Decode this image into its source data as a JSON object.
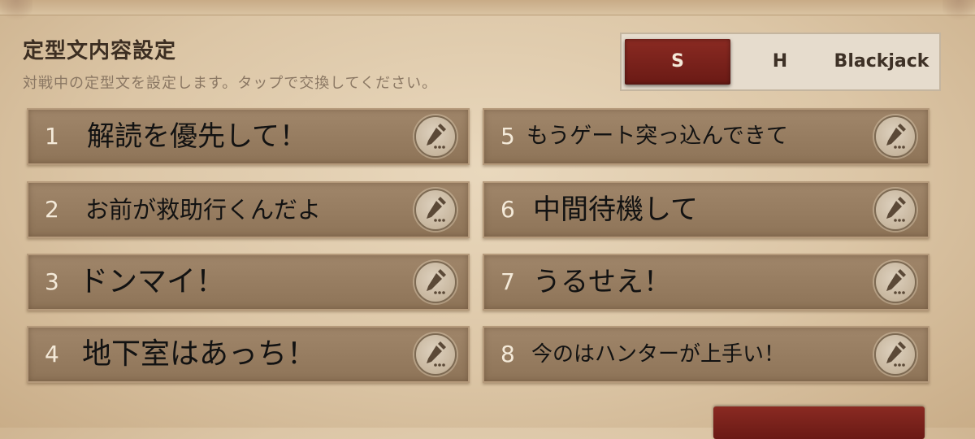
{
  "header": {
    "title": "定型文内容設定",
    "subtitle": "対戦中の定型文を設定します。タップで交換してください。"
  },
  "tabs": [
    {
      "label": "S",
      "selected": true
    },
    {
      "label": "H",
      "selected": false
    },
    {
      "label": "Blackjack",
      "selected": false
    }
  ],
  "slots": [
    {
      "number": "1",
      "text": "解読を優先して！"
    },
    {
      "number": "2",
      "text": "お前が救助行くんだよ"
    },
    {
      "number": "3",
      "text": "ドンマイ！"
    },
    {
      "number": "4",
      "text": "地下室はあっち！"
    },
    {
      "number": "5",
      "text": "もうゲート突っ込んできて"
    },
    {
      "number": "6",
      "text": "中間待機して"
    },
    {
      "number": "7",
      "text": "うるせえ！"
    },
    {
      "number": "8",
      "text": "今のはハンターが上手い！"
    }
  ],
  "icons": {
    "edit": "pencil-icon"
  },
  "colors": {
    "accent": "#7a231c",
    "slot_bg": "#97795d",
    "panel_bg": "#e3d0b3"
  }
}
